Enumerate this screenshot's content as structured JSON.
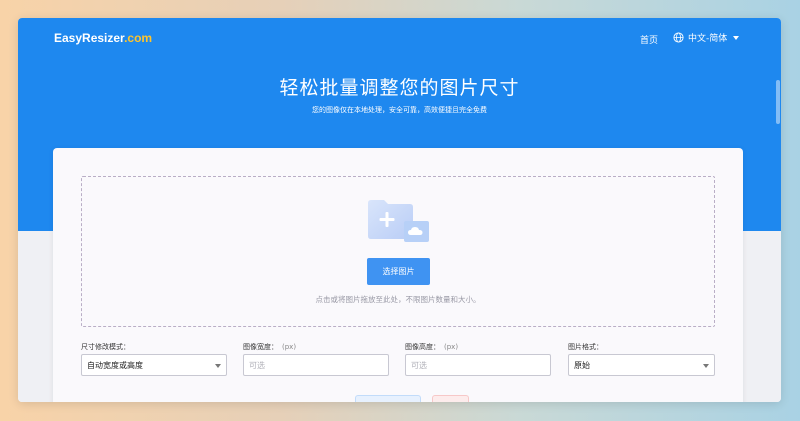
{
  "header": {
    "logo_main": "EasyResizer",
    "logo_suffix": ".com",
    "nav_home": "首页",
    "language": "中文-简体"
  },
  "hero": {
    "title": "轻松批量调整您的图片尺寸",
    "subtitle": "您的图像仅在本地处理，安全可靠，高效便捷且完全免费"
  },
  "upload": {
    "select_button": "选择图片",
    "hint": "点击或将图片拖放至此处，不限图片数量和大小。"
  },
  "fields": {
    "mode": {
      "label": "尺寸修改模式：",
      "value": "自动宽度或高度"
    },
    "width": {
      "label": "图像宽度：",
      "unit": "(px)",
      "placeholder": "可选"
    },
    "height": {
      "label": "图像高度：",
      "unit": "(px)",
      "placeholder": "可选"
    },
    "format": {
      "label": "图片格式：",
      "value": "原始"
    }
  },
  "colors": {
    "brand_blue": "#1e88ef",
    "button_blue": "#3f93f2",
    "logo_accent": "#ffc42c"
  },
  "icons": {
    "language": "globe-icon",
    "upload": "folder-add-icon"
  }
}
